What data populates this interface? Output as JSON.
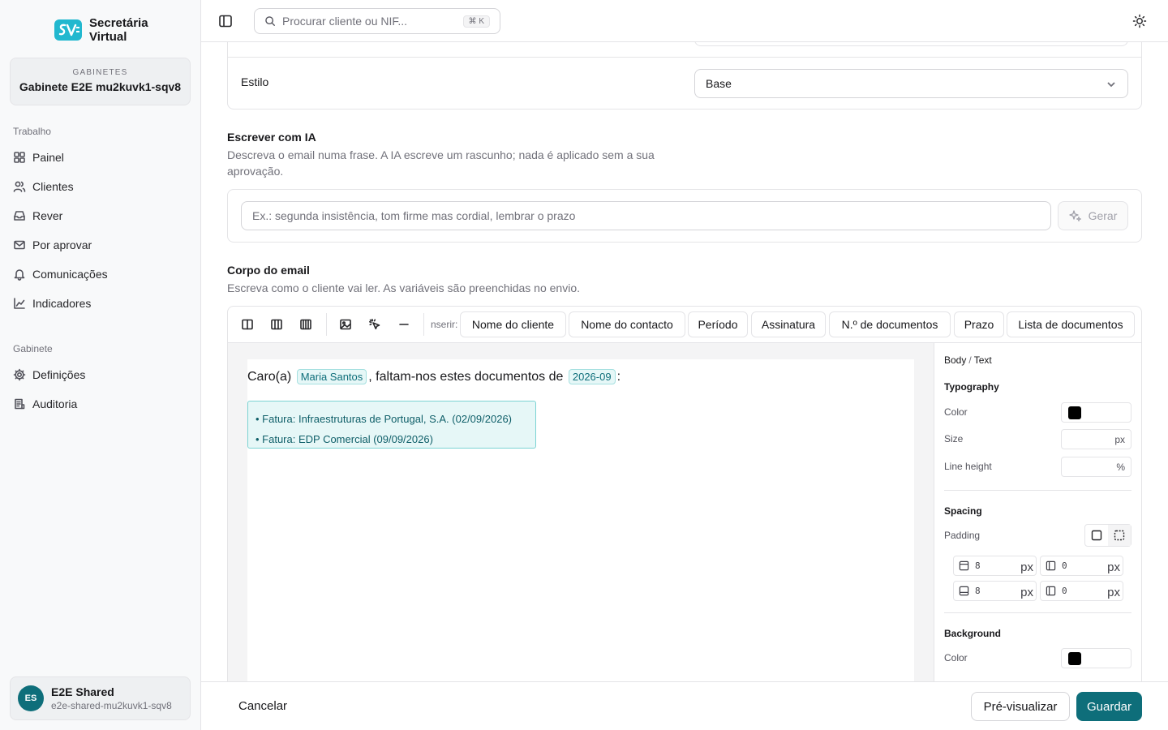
{
  "brand": {
    "line1": "Secretária",
    "line2": "Virtual",
    "accent": "#0891b2"
  },
  "workspace": {
    "caption": "GABINETES",
    "name": "Gabinete E2E mu2kuvk1-sqv8"
  },
  "nav": {
    "work_label": "Trabalho",
    "work_items": [
      {
        "label": "Painel",
        "icon": "grid-icon"
      },
      {
        "label": "Clientes",
        "icon": "users-icon"
      },
      {
        "label": "Rever",
        "icon": "inbox-icon"
      },
      {
        "label": "Por aprovar",
        "icon": "mail-icon"
      },
      {
        "label": "Comunicações",
        "icon": "bell-icon"
      },
      {
        "label": "Indicadores",
        "icon": "chart-icon"
      }
    ],
    "office_label": "Gabinete",
    "office_items": [
      {
        "label": "Definições",
        "icon": "gear-icon"
      },
      {
        "label": "Auditoria",
        "icon": "log-icon"
      }
    ]
  },
  "user": {
    "initials": "ES",
    "name": "E2E Shared",
    "email": "e2e-shared-mu2kuvk1-sqv8"
  },
  "search": {
    "placeholder": "Procurar cliente ou NIF...",
    "shortcut": "⌘ K"
  },
  "form": {
    "style_label": "Estilo",
    "style_value": "Base"
  },
  "ai": {
    "title": "Escrever com IA",
    "description": "Descreva o email numa frase. A IA escreve um rascunho; nada é aplicado sem a sua aprovação.",
    "placeholder": "Ex.: segunda insistência, tom firme mas cordial, lembrar o prazo",
    "generate_label": "Gerar"
  },
  "body_section": {
    "title": "Corpo do email",
    "description": "Escreva como o cliente vai ler. As variáveis são preenchidas no envio."
  },
  "editor": {
    "insert_label": "nserir:",
    "chips": [
      "Nome do cliente",
      "Nome do contacto",
      "Período",
      "Assinatura",
      "N.º de documentos",
      "Prazo",
      "Lista de documentos"
    ],
    "email": {
      "greeting": "Caro(a)",
      "client_var": "Maria Santos",
      "middle": ", faltam-nos estes documentos de",
      "period_var": "2026-09",
      "end": ":",
      "documents": [
        "• Fatura: Infraestruturas de Portugal, S.A. (02/09/2026)",
        "• Fatura: EDP Comercial (09/09/2026)"
      ]
    }
  },
  "props": {
    "crumb_a": "Body",
    "crumb_sep": "/",
    "crumb_b": "Text",
    "typography": "Typography",
    "color_label": "Color",
    "size_label": "Size",
    "size_unit": "px",
    "line_height_label": "Line height",
    "line_height_unit": "%",
    "spacing": "Spacing",
    "padding_label": "Padding",
    "padding": {
      "top": "8",
      "right": "0",
      "bottom": "8",
      "left": "0",
      "unit": "px"
    },
    "background": "Background",
    "bg_color_label": "Color",
    "text_color": "#000000",
    "bg_color": "#000000"
  },
  "footer": {
    "cancel_label": "Cancelar",
    "preview_label": "Pré-visualizar",
    "save_label": "Guardar"
  },
  "colors": {
    "primary": "#0e6e7a",
    "variable_bg": "#e6f7f7"
  }
}
